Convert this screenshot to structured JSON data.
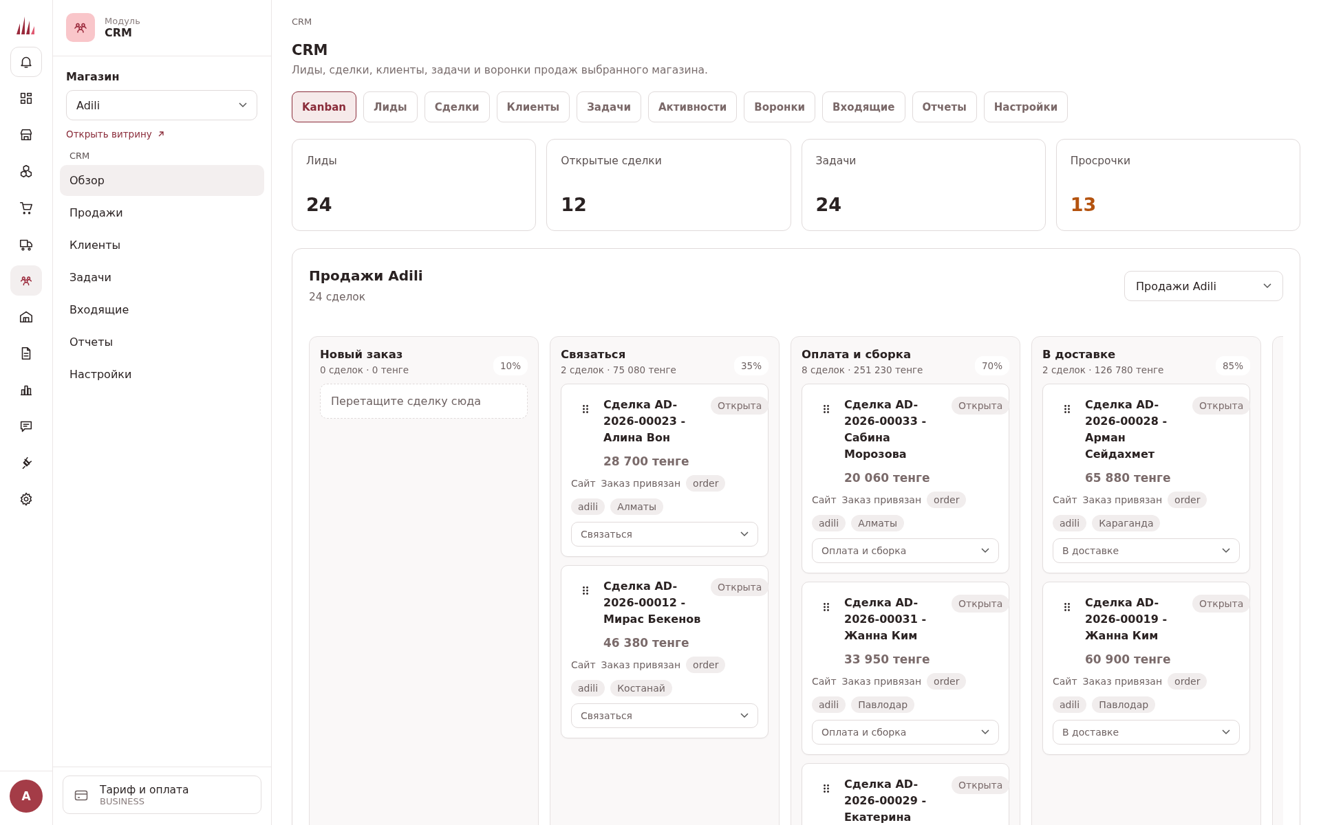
{
  "rail": {
    "items": [
      {
        "kind": "boxed",
        "selected": false
      },
      {
        "kind": "plain",
        "selected": false
      },
      {
        "kind": "plain",
        "selected": false
      },
      {
        "kind": "plain",
        "selected": false
      },
      {
        "kind": "plain",
        "selected": false
      },
      {
        "kind": "plain",
        "selected": false
      },
      {
        "kind": "plain",
        "selected": true
      },
      {
        "kind": "plain",
        "selected": false
      },
      {
        "kind": "plain",
        "selected": false
      },
      {
        "kind": "plain",
        "selected": false
      },
      {
        "kind": "plain",
        "selected": false
      },
      {
        "kind": "plain",
        "selected": false
      },
      {
        "kind": "plain",
        "selected": false
      }
    ],
    "avatar": "A"
  },
  "sidebar": {
    "module_label": "Модуль",
    "module_name": "CRM",
    "store_label": "Магазин",
    "store_value": "Adili",
    "store_link": "Открыть витрину",
    "section": "CRM",
    "items": [
      {
        "label": "Обзор",
        "selected": true
      },
      {
        "label": "Продажи",
        "selected": false
      },
      {
        "label": "Клиенты",
        "selected": false
      },
      {
        "label": "Задачи",
        "selected": false
      },
      {
        "label": "Входящие",
        "selected": false
      },
      {
        "label": "Отчеты",
        "selected": false
      },
      {
        "label": "Настройки",
        "selected": false
      }
    ],
    "billing": {
      "title": "Тариф и оплата",
      "plan": "BUSINESS"
    }
  },
  "breadcrumb": "CRM",
  "title": "CRM",
  "subtitle": "Лиды, сделки, клиенты, задачи и воронки продаж выбранного магазина.",
  "tabs": [
    {
      "label": "Kanban",
      "selected": true
    },
    {
      "label": "Лиды",
      "selected": false
    },
    {
      "label": "Сделки",
      "selected": false
    },
    {
      "label": "Клиенты",
      "selected": false
    },
    {
      "label": "Задачи",
      "selected": false
    },
    {
      "label": "Активности",
      "selected": false
    },
    {
      "label": "Воронки",
      "selected": false
    },
    {
      "label": "Входящие",
      "selected": false
    },
    {
      "label": "Отчеты",
      "selected": false
    },
    {
      "label": "Настройки",
      "selected": false
    }
  ],
  "stats": [
    {
      "label": "Лиды",
      "value": "24",
      "color": "#2a2222"
    },
    {
      "label": "Открытые сделки",
      "value": "12",
      "color": "#2a2222"
    },
    {
      "label": "Задачи",
      "value": "24",
      "color": "#2a2222"
    },
    {
      "label": "Просрочки",
      "value": "13",
      "color": "#b4530f"
    }
  ],
  "pipeline": {
    "title": "Продажи Adili",
    "count": "24 сделок",
    "select": "Продажи Adili",
    "columns": [
      {
        "title": "Новый заказ",
        "summary": "0 сделок · 0 тенге",
        "percent": "10%",
        "empty_hint": "Перетащите сделку сюда"
      },
      {
        "title": "Связаться",
        "summary": "2 сделок · 75 080 тенге",
        "percent": "35%",
        "deals": [
          {
            "title": "Сделка AD-2026-00023 - Алина Вон",
            "status": "Открыта",
            "amount": "28 700 тенге",
            "source": "Сайт",
            "note": "Заказ привязан",
            "label": "order",
            "tags": [
              "adili",
              "Алматы"
            ],
            "stage": "Связаться"
          },
          {
            "title": "Сделка AD-2026-00012 - Мирас Бекенов",
            "status": "Открыта",
            "amount": "46 380 тенге",
            "source": "Сайт",
            "note": "Заказ привязан",
            "label": "order",
            "tags": [
              "adili",
              "Костанай"
            ],
            "stage": "Связаться"
          }
        ]
      },
      {
        "title": "Оплата и сборка",
        "summary": "8 сделок · 251 230 тенге",
        "percent": "70%",
        "deals": [
          {
            "title": "Сделка AD-2026-00033 - Сабина Морозова",
            "status": "Открыта",
            "amount": "20 060 тенге",
            "source": "Сайт",
            "note": "Заказ привязан",
            "label": "order",
            "tags": [
              "adili",
              "Алматы"
            ],
            "stage": "Оплата и сборка"
          },
          {
            "title": "Сделка AD-2026-00031 - Жанна Ким",
            "status": "Открыта",
            "amount": "33 950 тенге",
            "source": "Сайт",
            "note": "Заказ привязан",
            "label": "order",
            "tags": [
              "adili",
              "Павлодар"
            ],
            "stage": "Оплата и сборка"
          },
          {
            "title": "Сделка AD-2026-00029 - Екатерина",
            "status": "Открыта"
          }
        ]
      },
      {
        "title": "В доставке",
        "summary": "2 сделок · 126 780 тенге",
        "percent": "85%",
        "deals": [
          {
            "title": "Сделка AD-2026-00028 - Арман Сейдахмет",
            "status": "Открыта",
            "amount": "65 880 тенге",
            "source": "Сайт",
            "note": "Заказ привязан",
            "label": "order",
            "tags": [
              "adili",
              "Караганда"
            ],
            "stage": "В доставке"
          },
          {
            "title": "Сделка AD-2026-00019 - Жанна Ким",
            "status": "Открыта",
            "amount": "60 900 тенге",
            "source": "Сайт",
            "note": "Заказ привязан",
            "label": "order",
            "tags": [
              "adili",
              "Павлодар"
            ],
            "stage": "В доставке"
          }
        ]
      }
    ]
  }
}
